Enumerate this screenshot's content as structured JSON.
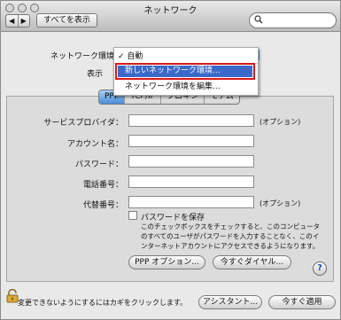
{
  "window": {
    "title": "ネットワーク",
    "nav_back": "◀",
    "nav_forward": "▶",
    "show_all": "すべてを表示"
  },
  "labels": {
    "location": "ネットワーク環境：",
    "show": "表示"
  },
  "location_menu": {
    "checked_prefix": "✓",
    "items": [
      "自動",
      "新しいネットワーク環境...",
      "ネットワーク環境を編集..."
    ]
  },
  "tabs": [
    "PPP",
    "TCP/IP",
    "プロキシ",
    "モデム"
  ],
  "fields": [
    {
      "label": "サービスプロバイダ：",
      "value": "",
      "note": "(オプション)"
    },
    {
      "label": "アカウント名：",
      "value": "",
      "note": ""
    },
    {
      "label": "パスワード：",
      "value": "",
      "note": ""
    },
    {
      "label": "電話番号：",
      "value": "",
      "note": ""
    },
    {
      "label": "代替番号：",
      "value": "",
      "note": "(オプション)"
    }
  ],
  "save_password": {
    "label": "パスワードを保存",
    "checked": false,
    "description": "このチェックボックスをチェックすると、このコンピュータのすべてのユーザがパスワードを入力することなく、このインターネットアカウントにアクセスできるようになります。"
  },
  "buttons": {
    "ppp_options": "PPP オプション...",
    "dial_now": "今すぐダイヤル...",
    "help": "?",
    "assistant": "アシスタント...",
    "apply_now": "今すぐ適用"
  },
  "footer": {
    "lock_text": "変更できないようにするにはカギをクリックします。"
  },
  "colors": {
    "selection": "#3a69c9",
    "highlight_border": "#d81818",
    "tab_selected": "#4a8ed8"
  }
}
